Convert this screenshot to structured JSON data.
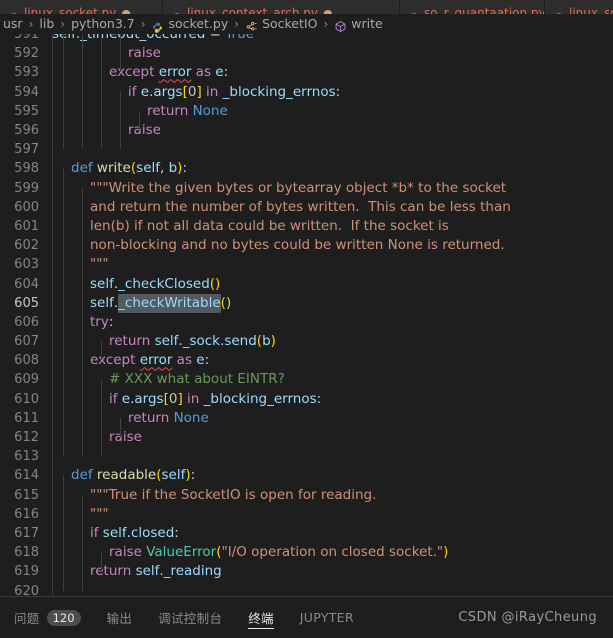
{
  "window": {
    "theme": "Dark+ (VS Code)",
    "background": "#1e1e1e",
    "accent": "#569cd6"
  },
  "tabs": [
    {
      "label": "linux_socket.py",
      "icon": "python-file-icon",
      "modified": true,
      "active": false
    },
    {
      "label": "linux_context_arch.py",
      "icon": "python-file-icon",
      "modified": true,
      "active": false
    },
    {
      "label": "so_r_quantaation.py",
      "icon": "python-file-icon",
      "modified": false,
      "active": false
    },
    {
      "label": "linux_soc",
      "icon": "python-file-icon",
      "modified": false,
      "active": false
    }
  ],
  "breadcrumb": {
    "separator": "›",
    "items": [
      {
        "label": "usr",
        "icon": null
      },
      {
        "label": "lib",
        "icon": null
      },
      {
        "label": "python3.7",
        "icon": null
      },
      {
        "label": "socket.py",
        "icon": "python-file-icon"
      },
      {
        "label": "SocketIO",
        "icon": "symbol-class-icon"
      },
      {
        "label": "write",
        "icon": "symbol-method-icon"
      }
    ]
  },
  "editor": {
    "selection": "_checkWritable",
    "current_line": 605,
    "first_line": 591,
    "last_line": 620,
    "lines": [
      {
        "n": 591,
        "clipped": true,
        "tokens": [
          {
            "t": "self",
            "c": "var"
          },
          {
            "t": ".",
            "c": "punc"
          },
          {
            "t": "_timeout_occurred",
            "c": "var"
          },
          {
            "t": " = ",
            "c": "punc"
          },
          {
            "t": "True",
            "c": "kw2"
          }
        ],
        "indent_guides": 4,
        "text": "self._timeout_occurred = True"
      },
      {
        "n": 592,
        "tokens": [
          {
            "t": "raise",
            "c": "kw"
          }
        ],
        "indent_guides": 4,
        "indent": 4,
        "text": "raise"
      },
      {
        "n": 593,
        "tokens": [
          {
            "t": "except ",
            "c": "kw"
          },
          {
            "t": "error",
            "c": "var err"
          },
          {
            "t": " as ",
            "c": "kw"
          },
          {
            "t": "e",
            "c": "var"
          },
          {
            "t": ":",
            "c": "punc"
          }
        ],
        "indent_guides": 3,
        "indent": 3,
        "text": "except error as e:"
      },
      {
        "n": 594,
        "tokens": [
          {
            "t": "if ",
            "c": "kw"
          },
          {
            "t": "e",
            "c": "var"
          },
          {
            "t": ".",
            "c": "punc"
          },
          {
            "t": "args",
            "c": "var"
          },
          {
            "t": "[",
            "c": "br-y"
          },
          {
            "t": "0",
            "c": "num"
          },
          {
            "t": "]",
            "c": "br-y"
          },
          {
            "t": " in ",
            "c": "kw"
          },
          {
            "t": "_blocking_errnos",
            "c": "var"
          },
          {
            "t": ":",
            "c": "punc"
          }
        ],
        "indent_guides": 4,
        "indent": 4,
        "text": "if e.args[0] in _blocking_errnos:"
      },
      {
        "n": 595,
        "tokens": [
          {
            "t": "return ",
            "c": "kw"
          },
          {
            "t": "None",
            "c": "kw2"
          }
        ],
        "indent_guides": 5,
        "indent": 5,
        "text": "return None"
      },
      {
        "n": 596,
        "tokens": [
          {
            "t": "raise",
            "c": "kw"
          }
        ],
        "indent_guides": 4,
        "indent": 4,
        "text": "raise"
      },
      {
        "n": 597,
        "tokens": [],
        "indent_guides": 0,
        "indent": 0,
        "text": ""
      },
      {
        "n": 598,
        "tokens": [
          {
            "t": "def ",
            "c": "kw2"
          },
          {
            "t": "write",
            "c": "fn"
          },
          {
            "t": "(",
            "c": "br-y"
          },
          {
            "t": "self",
            "c": "var"
          },
          {
            "t": ", ",
            "c": "punc"
          },
          {
            "t": "b",
            "c": "var"
          },
          {
            "t": ")",
            "c": "br-y"
          },
          {
            "t": ":",
            "c": "punc"
          }
        ],
        "indent_guides": 1,
        "indent": 1,
        "text": "def write(self, b):"
      },
      {
        "n": 599,
        "tokens": [
          {
            "t": "\"\"\"Write the given bytes or bytearray object *b* to the socket",
            "c": "str"
          }
        ],
        "indent_guides": 2,
        "indent": 2,
        "text": "\"\"\"Write the given bytes or bytearray object *b* to the socket"
      },
      {
        "n": 600,
        "tokens": [
          {
            "t": "and return the number of bytes written.  This can be less than",
            "c": "str"
          }
        ],
        "indent_guides": 2,
        "indent": 2,
        "text": "and return the number of bytes written.  This can be less than"
      },
      {
        "n": 601,
        "tokens": [
          {
            "t": "len(b) if not all data could be written.  If the socket is",
            "c": "str"
          }
        ],
        "indent_guides": 2,
        "indent": 2,
        "text": "len(b) if not all data could be written.  If the socket is"
      },
      {
        "n": 602,
        "tokens": [
          {
            "t": "non-blocking and no bytes could be written None is returned.",
            "c": "str"
          }
        ],
        "indent_guides": 2,
        "indent": 2,
        "text": "non-blocking and no bytes could be written None is returned."
      },
      {
        "n": 603,
        "tokens": [
          {
            "t": "\"\"\"",
            "c": "str"
          }
        ],
        "indent_guides": 2,
        "indent": 2,
        "text": "\"\"\""
      },
      {
        "n": 604,
        "tokens": [
          {
            "t": "self",
            "c": "var"
          },
          {
            "t": ".",
            "c": "punc"
          },
          {
            "t": "_checkClosed",
            "c": "var"
          },
          {
            "t": "(",
            "c": "br-y"
          },
          {
            "t": ")",
            "c": "br-y"
          }
        ],
        "indent_guides": 2,
        "indent": 2,
        "text": "self._checkClosed()"
      },
      {
        "n": 605,
        "tokens": [
          {
            "t": "self",
            "c": "var"
          },
          {
            "t": ".",
            "c": "punc"
          },
          {
            "t": "_checkWritable",
            "c": "var sel"
          },
          {
            "t": "(",
            "c": "br-y"
          },
          {
            "t": ")",
            "c": "br-y"
          }
        ],
        "indent_guides": 2,
        "indent": 2,
        "text": "self._checkWritable()"
      },
      {
        "n": 606,
        "tokens": [
          {
            "t": "try",
            "c": "kw"
          },
          {
            "t": ":",
            "c": "punc"
          }
        ],
        "indent_guides": 2,
        "indent": 2,
        "text": "try:"
      },
      {
        "n": 607,
        "tokens": [
          {
            "t": "return ",
            "c": "kw"
          },
          {
            "t": "self",
            "c": "var"
          },
          {
            "t": ".",
            "c": "punc"
          },
          {
            "t": "_sock",
            "c": "var"
          },
          {
            "t": ".",
            "c": "punc"
          },
          {
            "t": "send",
            "c": "var"
          },
          {
            "t": "(",
            "c": "br-y"
          },
          {
            "t": "b",
            "c": "var"
          },
          {
            "t": ")",
            "c": "br-y"
          }
        ],
        "indent_guides": 3,
        "indent": 3,
        "text": "return self._sock.send(b)"
      },
      {
        "n": 608,
        "tokens": [
          {
            "t": "except ",
            "c": "kw"
          },
          {
            "t": "error",
            "c": "var err"
          },
          {
            "t": " as ",
            "c": "kw"
          },
          {
            "t": "e",
            "c": "var"
          },
          {
            "t": ":",
            "c": "punc"
          }
        ],
        "indent_guides": 2,
        "indent": 2,
        "text": "except error as e:"
      },
      {
        "n": 609,
        "tokens": [
          {
            "t": "# XXX what about EINTR?",
            "c": "cmt"
          }
        ],
        "indent_guides": 3,
        "indent": 3,
        "text": "# XXX what about EINTR?"
      },
      {
        "n": 610,
        "tokens": [
          {
            "t": "if ",
            "c": "kw"
          },
          {
            "t": "e",
            "c": "var"
          },
          {
            "t": ".",
            "c": "punc"
          },
          {
            "t": "args",
            "c": "var"
          },
          {
            "t": "[",
            "c": "br-y"
          },
          {
            "t": "0",
            "c": "num"
          },
          {
            "t": "]",
            "c": "br-y"
          },
          {
            "t": " in ",
            "c": "kw"
          },
          {
            "t": "_blocking_errnos",
            "c": "var"
          },
          {
            "t": ":",
            "c": "punc"
          }
        ],
        "indent_guides": 3,
        "indent": 3,
        "text": "if e.args[0] in _blocking_errnos:"
      },
      {
        "n": 611,
        "tokens": [
          {
            "t": "return ",
            "c": "kw"
          },
          {
            "t": "None",
            "c": "kw2"
          }
        ],
        "indent_guides": 4,
        "indent": 4,
        "text": "return None"
      },
      {
        "n": 612,
        "tokens": [
          {
            "t": "raise",
            "c": "kw"
          }
        ],
        "indent_guides": 3,
        "indent": 3,
        "text": "raise"
      },
      {
        "n": 613,
        "tokens": [],
        "indent_guides": 0,
        "indent": 0,
        "text": ""
      },
      {
        "n": 614,
        "tokens": [
          {
            "t": "def ",
            "c": "kw2"
          },
          {
            "t": "readable",
            "c": "fn"
          },
          {
            "t": "(",
            "c": "br-y"
          },
          {
            "t": "self",
            "c": "var"
          },
          {
            "t": ")",
            "c": "br-y"
          },
          {
            "t": ":",
            "c": "punc"
          }
        ],
        "indent_guides": 1,
        "indent": 1,
        "text": "def readable(self):"
      },
      {
        "n": 615,
        "tokens": [
          {
            "t": "\"\"\"True if the SocketIO is open for reading.",
            "c": "str"
          }
        ],
        "indent_guides": 2,
        "indent": 2,
        "text": "\"\"\"True if the SocketIO is open for reading."
      },
      {
        "n": 616,
        "tokens": [
          {
            "t": "\"\"\"",
            "c": "str"
          }
        ],
        "indent_guides": 2,
        "indent": 2,
        "text": "\"\"\""
      },
      {
        "n": 617,
        "tokens": [
          {
            "t": "if ",
            "c": "kw"
          },
          {
            "t": "self",
            "c": "var"
          },
          {
            "t": ".",
            "c": "punc"
          },
          {
            "t": "closed",
            "c": "var"
          },
          {
            "t": ":",
            "c": "punc"
          }
        ],
        "indent_guides": 2,
        "indent": 2,
        "text": "if self.closed:"
      },
      {
        "n": 618,
        "tokens": [
          {
            "t": "raise ",
            "c": "kw"
          },
          {
            "t": "ValueError",
            "c": "cls"
          },
          {
            "t": "(",
            "c": "br-y"
          },
          {
            "t": "\"I/O operation on closed socket.\"",
            "c": "str"
          },
          {
            "t": ")",
            "c": "br-y"
          }
        ],
        "indent_guides": 3,
        "indent": 3,
        "text": "raise ValueError(\"I/O operation on closed socket.\")"
      },
      {
        "n": 619,
        "tokens": [
          {
            "t": "return ",
            "c": "kw"
          },
          {
            "t": "self",
            "c": "var"
          },
          {
            "t": ".",
            "c": "punc"
          },
          {
            "t": "_reading",
            "c": "var"
          }
        ],
        "indent_guides": 2,
        "indent": 2,
        "text": "return self._reading"
      },
      {
        "n": 620,
        "tokens": [],
        "indent_guides": 0,
        "indent": 0,
        "text": ""
      }
    ]
  },
  "panel": {
    "tabs": [
      {
        "label": "问题",
        "badge": "120",
        "active": false
      },
      {
        "label": "输出",
        "badge": null,
        "active": false
      },
      {
        "label": "调试控制台",
        "badge": null,
        "active": false
      },
      {
        "label": "终端",
        "badge": null,
        "active": true
      },
      {
        "label": "JUPYTER",
        "badge": null,
        "active": false
      }
    ]
  },
  "watermark": {
    "text": "CSDN @iRayCheung"
  }
}
